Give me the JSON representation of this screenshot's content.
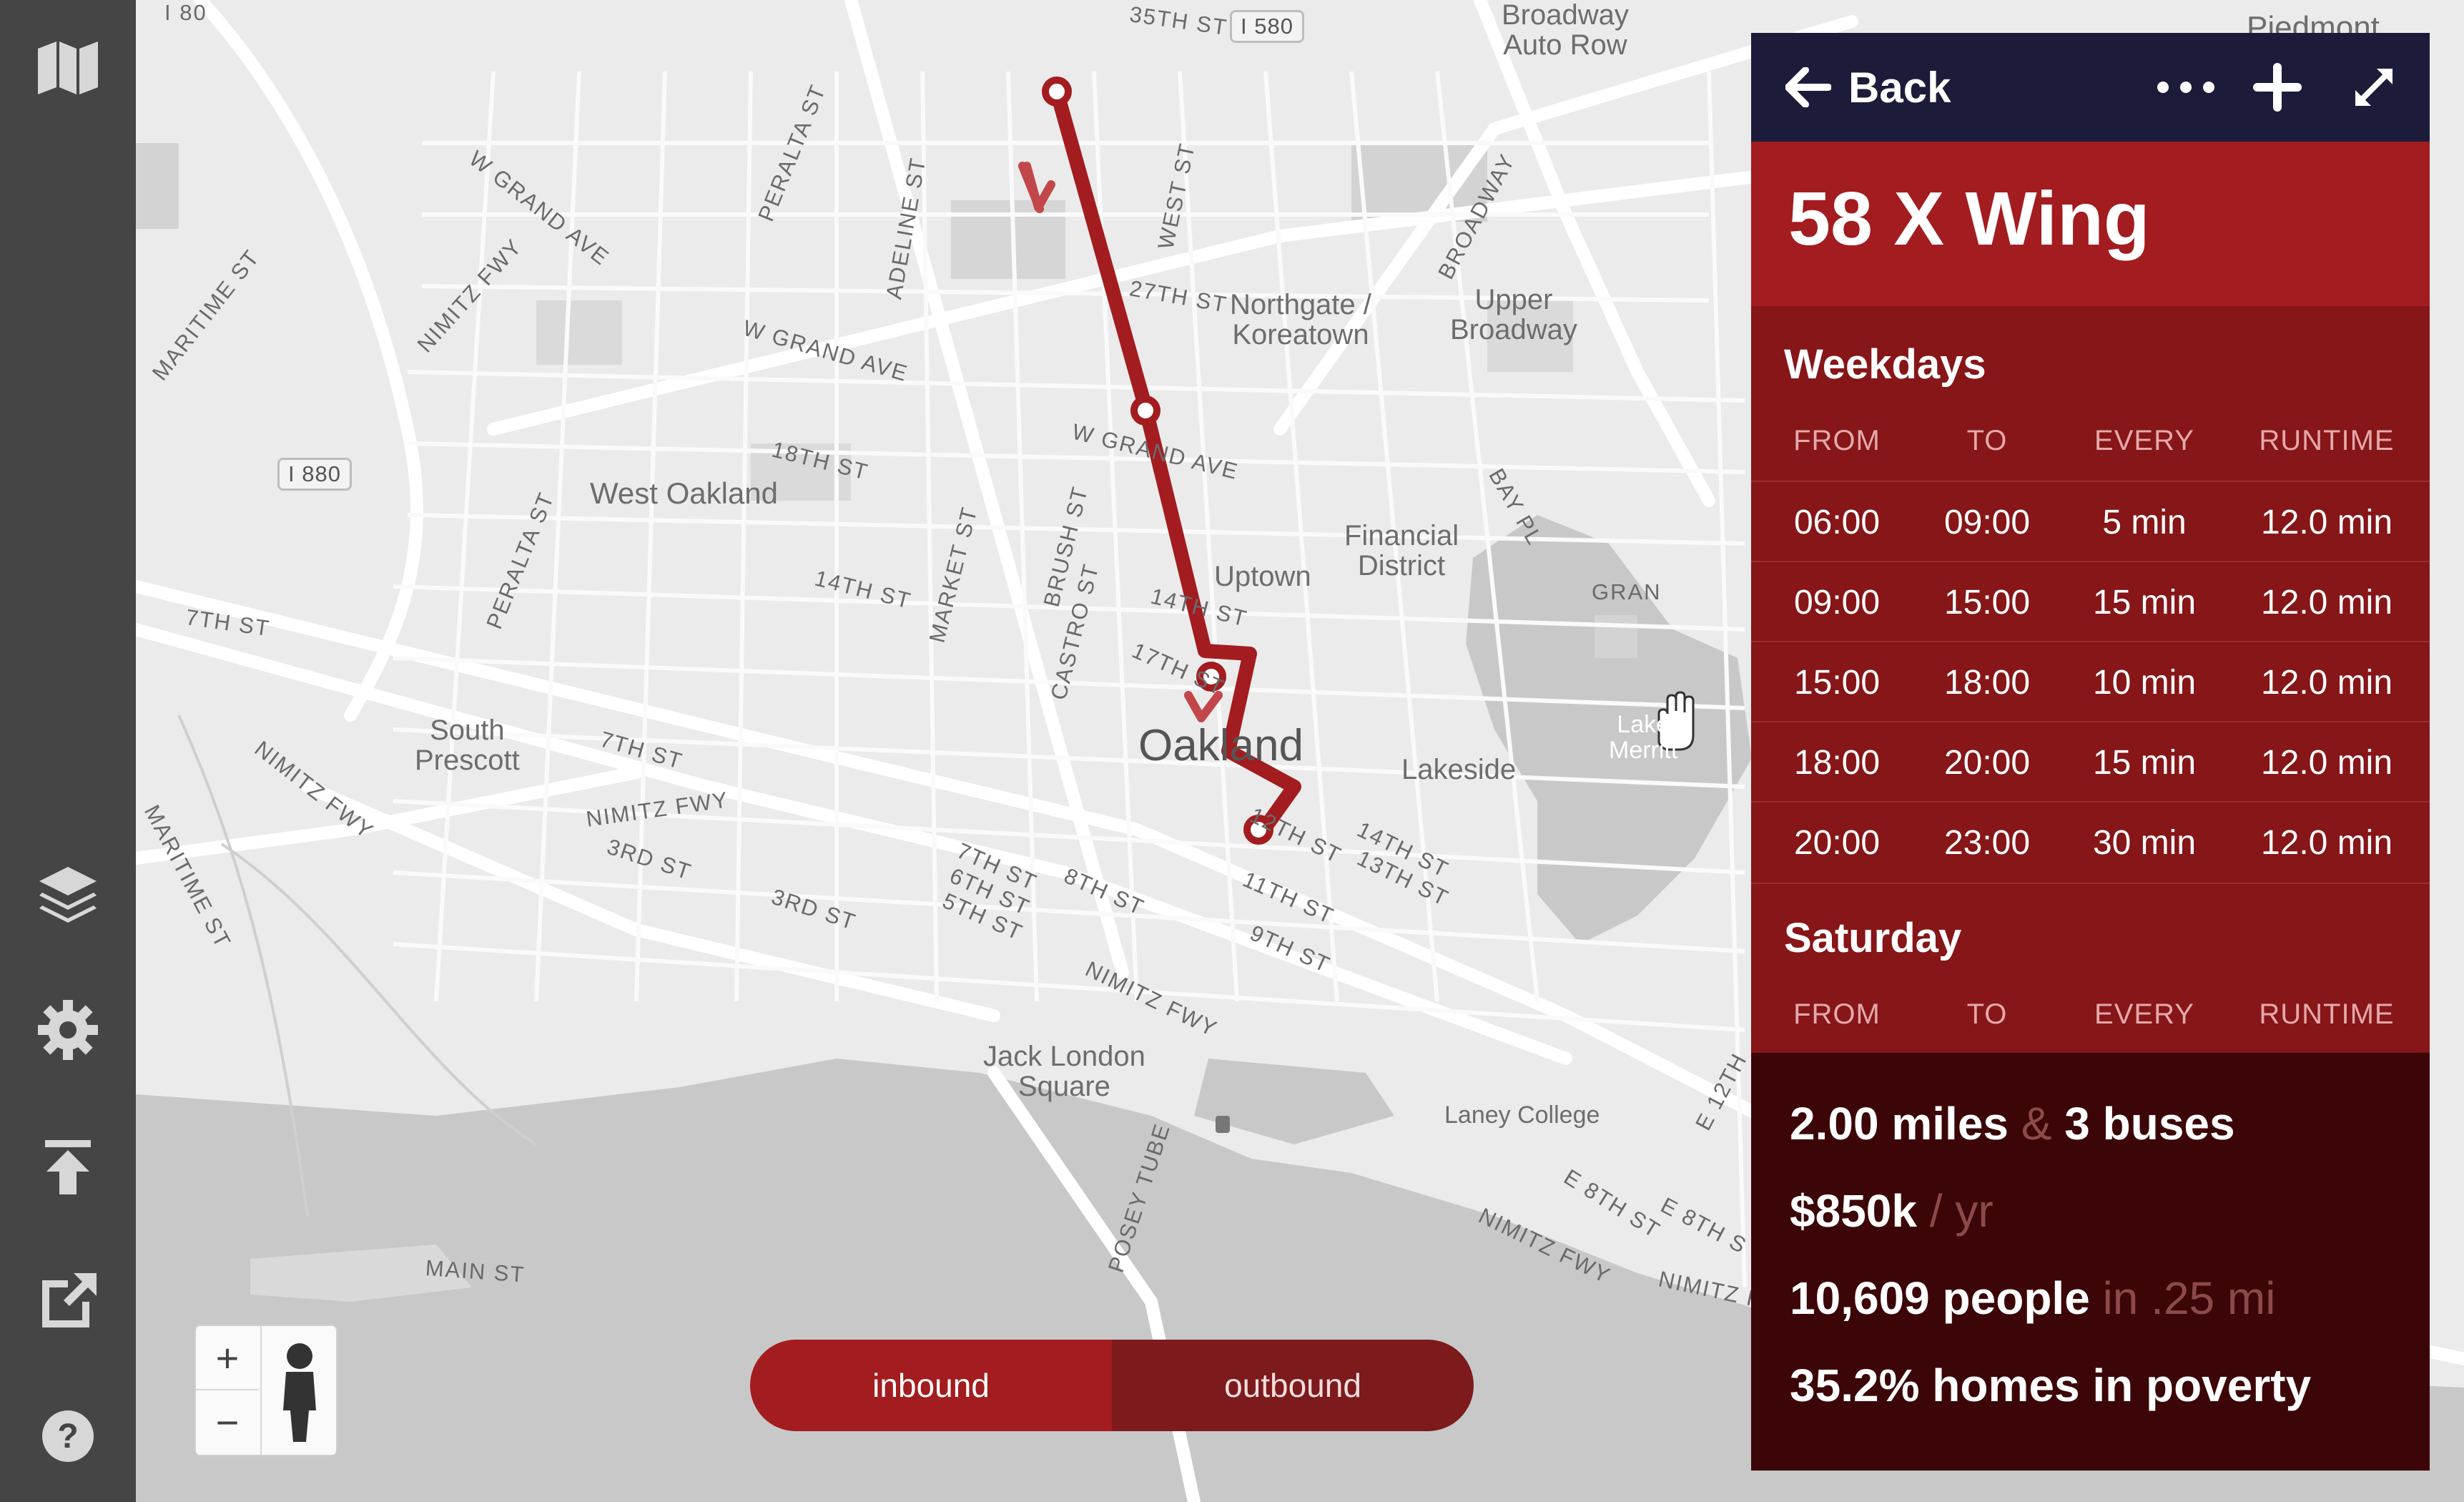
{
  "sidebar": {
    "icons": [
      "map-book-icon",
      "layers-icon",
      "gear-icon",
      "upload-icon",
      "export-icon",
      "help-icon"
    ]
  },
  "map": {
    "place_labels": {
      "broadway_auto_row": "Broadway\nAuto Row",
      "northgate": "Northgate /\nKoreatown",
      "upper_broadway": "Upper\nBroadway",
      "west_oakland": "West Oakland",
      "uptown": "Uptown",
      "financial": "Financial\nDistrict",
      "oakland": "Oakland",
      "lakeside": "Lakeside",
      "south_prescott": "South\nPrescott",
      "jack_london": "Jack London\nSquare",
      "laney": "Laney College",
      "lake_merritt": "Lake\nMerritt",
      "piedmont": "Piedmont"
    },
    "street_labels": [
      "I 80",
      "35TH ST",
      "PERALTA ST",
      "ADELINE ST",
      "WEST ST",
      "W GRAND AVE",
      "NIMITZ FWY",
      "MARITIME ST",
      "27TH ST",
      "W GRAND AVE",
      "BROADWAY",
      "18TH ST",
      "W GRAND AVE",
      "BAY PL",
      "PERALTA ST",
      "14TH ST",
      "MARKET ST",
      "BRUSH ST",
      "CASTRO ST",
      "7TH ST",
      "7TH ST",
      "NIMITZ FWY",
      "NIMITZ FWY",
      "3RD ST",
      "3RD ST",
      "7TH ST",
      "6TH ST",
      "5TH ST",
      "8TH ST",
      "9TH ST",
      "11TH ST",
      "14TH ST",
      "13TH ST",
      "NIMITZ FWY",
      "E 8TH ST",
      "NIMITZ FWY",
      "POSEY TUBE",
      "MAIN ST",
      "GRAN",
      "E 12TH",
      "E 8TH S",
      "MARITIME ST",
      "NIMITZ FWY",
      "12TH ST",
      "17TH ST",
      "14TH ST"
    ],
    "shields": {
      "i580": "I 580",
      "i880": "I 880"
    },
    "zoom": {
      "in": "+",
      "out": "−"
    }
  },
  "route_color": "#a31c1f",
  "toggle": {
    "inbound": "inbound",
    "outbound": "outbound",
    "selected": "inbound"
  },
  "panel": {
    "back_label": "Back",
    "more_label": "•••",
    "title": "58 X Wing",
    "weekdays": {
      "title": "Weekdays",
      "columns": [
        "FROM",
        "TO",
        "EVERY",
        "RUNTIME"
      ],
      "rows": [
        [
          "06:00",
          "09:00",
          "5 min",
          "12.0 min"
        ],
        [
          "09:00",
          "15:00",
          "15 min",
          "12.0 min"
        ],
        [
          "15:00",
          "18:00",
          "10 min",
          "12.0 min"
        ],
        [
          "18:00",
          "20:00",
          "15 min",
          "12.0 min"
        ],
        [
          "20:00",
          "23:00",
          "30 min",
          "12.0 min"
        ]
      ]
    },
    "saturday": {
      "title": "Saturday",
      "columns": [
        "FROM",
        "TO",
        "EVERY",
        "RUNTIME"
      ]
    },
    "stats": {
      "miles": "2.00 miles",
      "amp": "&",
      "buses": "3 buses",
      "cost": "$850k",
      "per_yr": "/ yr",
      "people": "10,609 people",
      "radius": "in .25 mi",
      "poverty": "35.2% homes in poverty"
    }
  }
}
